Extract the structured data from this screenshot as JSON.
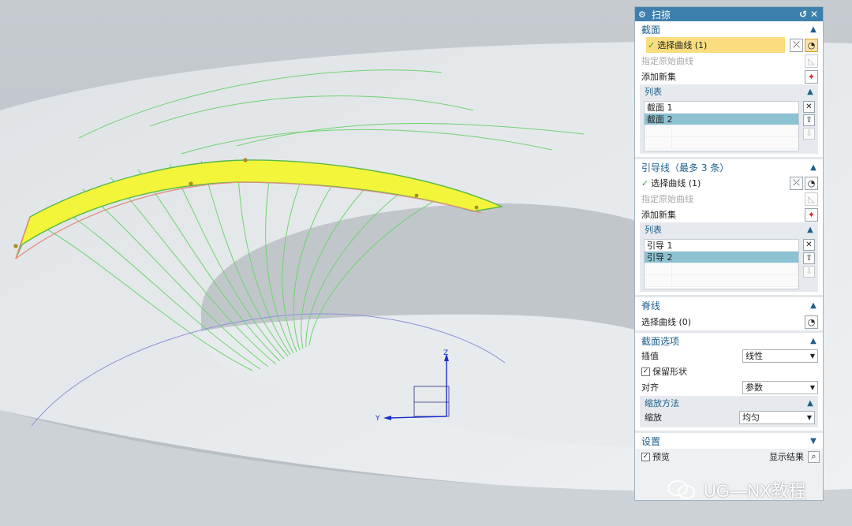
{
  "dialog": {
    "title": "扫掠",
    "section_section": {
      "label": "截面",
      "select_curve": "选择曲线 (1)",
      "specify_origin_curve": "指定原始曲线",
      "add_new_set": "添加新集",
      "list_label": "列表",
      "items": [
        "截面 1",
        "截面 2"
      ]
    },
    "guide_section": {
      "label": "引导线（最多 3 条）",
      "select_curve": "选择曲线 (1)",
      "specify_origin_curve": "指定原始曲线",
      "add_new_set": "添加新集",
      "list_label": "列表",
      "items": [
        "引导 1",
        "引导 2"
      ]
    },
    "spine_section": {
      "label": "脊线",
      "select_curve": "选择曲线 (0)"
    },
    "section_options": {
      "label": "截面选项",
      "interpolation_label": "插值",
      "interpolation_value": "线性",
      "preserve_shape_label": "保留形状",
      "preserve_shape_checked": true,
      "alignment_label": "对齐",
      "alignment_value": "参数",
      "scaling_method_label": "缩放方法",
      "scaling_label": "缩放",
      "scaling_value": "均匀"
    },
    "settings": {
      "label": "设置",
      "preview_label": "预览",
      "preview_checked": true,
      "show_result_label": "显示结果"
    }
  },
  "viewport": {
    "axis_z": "Z",
    "axis_y": "Y",
    "surface_color": "#f2f53a",
    "guide_curve_color": "#6fd36f",
    "spine_curve_color": "#8a95d8"
  },
  "watermark": {
    "text": "UG—NX教程"
  }
}
